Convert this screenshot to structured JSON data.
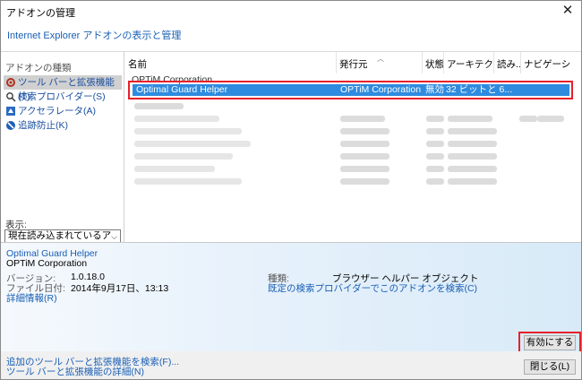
{
  "window": {
    "title": "アドオンの管理",
    "close_glyph": "✕",
    "header_link": "Internet Explorer アドオンの表示と管理"
  },
  "sidebar": {
    "types_label": "アドオンの種類",
    "items": [
      {
        "label": "ツール バーと拡張機能(T)",
        "icon": "gear-icon",
        "selected": true
      },
      {
        "label": "検索プロバイダー(S)",
        "icon": "search-icon"
      },
      {
        "label": "アクセラレータ(A)",
        "icon": "accelerator-icon"
      },
      {
        "label": "追跡防止(K)",
        "icon": "block-icon"
      }
    ],
    "show_label": "表示:",
    "show_value": "現在読み込まれているアドオン"
  },
  "list": {
    "columns": [
      "名前",
      "発行元",
      "状態",
      "アーキテクチャ",
      "読み...",
      "ナビゲーショ..."
    ],
    "group": "OPTiM Corporation",
    "selected_row": {
      "name": "Optimal Guard Helper",
      "publisher": "OPTiM Corporation",
      "status": "無効",
      "arch": "32 ビットと 6..."
    }
  },
  "details": {
    "name": "Optimal Guard Helper",
    "publisher": "OPTiM Corporation",
    "version_label": "バージョン:",
    "version": "1.0.18.0",
    "date_label": "ファイル日付:",
    "date": "2014年9月17日、13:13",
    "more_info": "詳細情報(R)",
    "type_label": "種類:",
    "type": "ブラウザー ヘルパー オブジェクト",
    "search_link": "既定の検索プロバイダーでこのアドオンを検索(C)"
  },
  "actions": {
    "enable": "有効にする(E)",
    "close": "閉じる(L)"
  },
  "footer": {
    "find_more": "追加のツール バーと拡張機能を検索(F)...",
    "learn_more": "ツール バーと拡張機能の詳細(N)"
  },
  "colors": {
    "link": "#1a5fb4",
    "selection": "#2e8bdf",
    "highlight_box": "#e8202a"
  }
}
